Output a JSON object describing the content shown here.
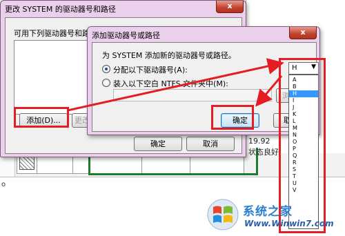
{
  "background": {
    "right_line_1": "19.92",
    "right_line_2": "状态良好",
    "left_letter": "o"
  },
  "outer_dialog": {
    "title": "更改 SYSTEM 的驱动器号和路径",
    "close_label": "x",
    "list_label": "可用下列驱动器号和路径",
    "add_label": "添加(D)...",
    "change_label": "更改",
    "ok_label": "确定",
    "cancel_label": "取消"
  },
  "add_dialog": {
    "title": "添加驱动器号或路径",
    "close_label": "x",
    "instruction": "为 SYSTEM 添加新的驱动器号或路径。",
    "option_assign_label": "分配以下驱动器号(A):",
    "option_mount_label": "装入以下空白 NTFS 文件夹中(M):",
    "browse_label": "浏览",
    "ok_label": "确定",
    "cancel_label": "取"
  },
  "drive_letter": {
    "selected": "H",
    "options": [
      "A",
      "B",
      "H",
      "I",
      "J",
      "K",
      "L",
      "M",
      "N",
      "O",
      "P",
      "Q",
      "R",
      "S",
      "T",
      "U",
      "V"
    ],
    "highlighted": "H"
  },
  "watermark": {
    "title": "系统之家",
    "url": "Www.Winwin7.com"
  },
  "colors": {
    "annotation_red": "#e51c23",
    "window_frame_pink": "#ead0ea",
    "selection_blue": "#3399ff",
    "close_red": "#c2412c"
  }
}
